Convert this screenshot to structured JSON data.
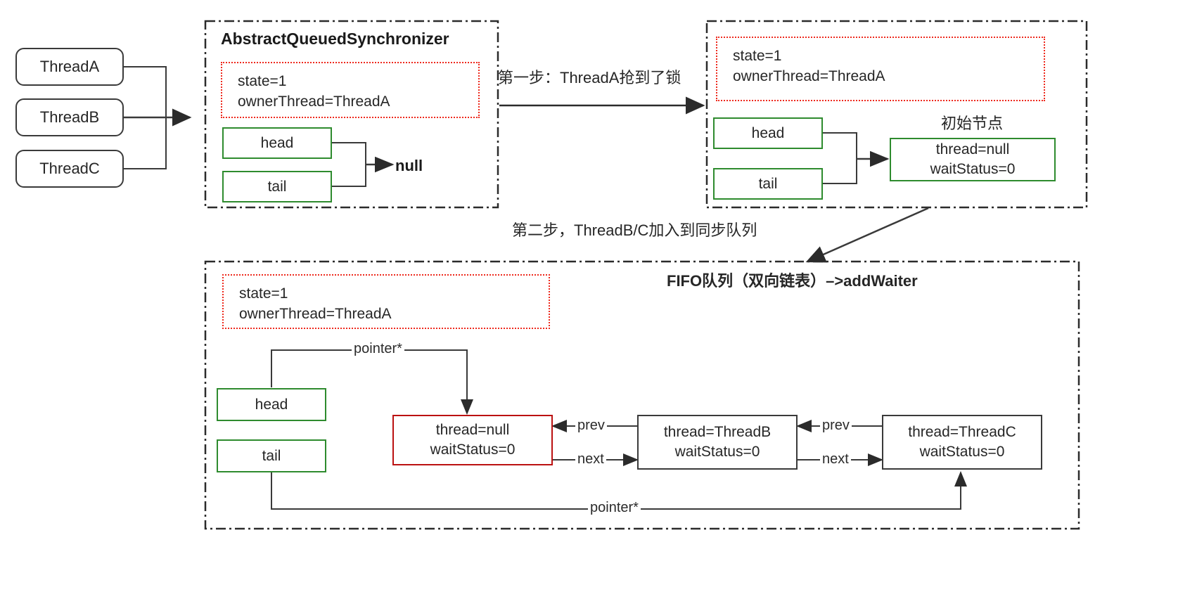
{
  "diagram": {
    "threads": [
      {
        "label": "ThreadA"
      },
      {
        "label": "ThreadB"
      },
      {
        "label": "ThreadC"
      }
    ],
    "step1_label": "第一步：ThreadA抢到了锁",
    "step2_label": "第二步，ThreadB/C加入到同步队列",
    "fifo_caption": "FIFO队列（双向链表）–>addWaiter",
    "panel_aqs": {
      "title": "AbstractQueuedSynchronizer",
      "state_lines": [
        "state=1",
        "ownerThread=ThreadA"
      ],
      "head_label": "head",
      "tail_label": "tail",
      "target_label": "null"
    },
    "panel_after_lock": {
      "state_lines": [
        "state=1",
        "ownerThread=ThreadA"
      ],
      "head_label": "head",
      "tail_label": "tail",
      "initial_node_caption": "初始节点",
      "initial_node_lines": [
        "thread=null",
        "waitStatus=0"
      ]
    },
    "panel_queue": {
      "state_lines": [
        "state=1",
        "ownerThread=ThreadA"
      ],
      "head_label": "head",
      "tail_label": "tail",
      "head_pointer_label": "pointer*",
      "tail_pointer_label": "pointer*",
      "nodes": [
        {
          "line1": "thread=null",
          "line2": "waitStatus=0",
          "accent": "#bb1111"
        },
        {
          "line1": "thread=ThreadB",
          "line2": "waitStatus=0",
          "accent": "#3a3a3a"
        },
        {
          "line1": "thread=ThreadC",
          "line2": "waitStatus=0",
          "accent": "#3a3a3a"
        }
      ],
      "link_labels": {
        "prev_1": "prev",
        "next_1": "next",
        "prev_2": "prev",
        "next_2": "next"
      }
    },
    "colors": {
      "state_border": "#ee2a1e",
      "green_border": "#2e8b2e",
      "red_node_border": "#bb1111",
      "line": "#3a3a3a",
      "panel_border": "#2b2b2b"
    }
  }
}
